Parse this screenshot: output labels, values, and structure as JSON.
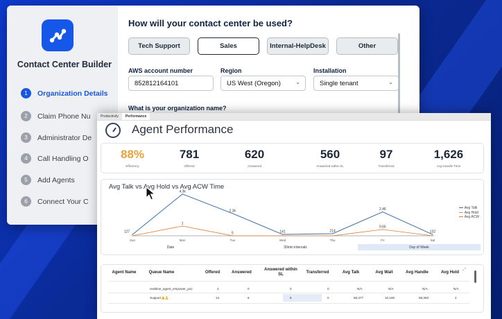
{
  "builder": {
    "app_name": "Contact Center Builder",
    "question": "How will your contact center be used?",
    "options": [
      "Tech Support",
      "Sales",
      "Internal-HelpDesk",
      "Other"
    ],
    "selected_option": "Sales",
    "steps": [
      {
        "num": "1",
        "label": "Organization Details"
      },
      {
        "num": "2",
        "label": "Claim Phone Nu"
      },
      {
        "num": "3",
        "label": "Administrator De"
      },
      {
        "num": "4",
        "label": "Call Handling O"
      },
      {
        "num": "5",
        "label": "Add Agents"
      },
      {
        "num": "6",
        "label": "Connect Your C"
      }
    ],
    "aws_label": "AWS account number",
    "aws_value": "852812164101",
    "region_label": "Region",
    "region_value": "US West (Oregon)",
    "install_label": "Installation",
    "install_value": "Single tenant",
    "org_question": "What is your organization name?"
  },
  "dashboard": {
    "tabs": [
      "Productivity",
      "Performance"
    ],
    "active_tab": "Performance",
    "title": "Agent Performance",
    "kpis": [
      {
        "value": "88%",
        "label": "Efficiency"
      },
      {
        "value": "781",
        "label": "Offered"
      },
      {
        "value": "620",
        "label": "Answered"
      },
      {
        "value": "560",
        "label": "Answered within SL"
      },
      {
        "value": "97",
        "label": "Transferred"
      },
      {
        "value": "1,626",
        "label": "Avg Handle Time"
      }
    ],
    "controls": [
      "Date",
      "30min intervals",
      "Day of Week"
    ],
    "table_headers": [
      "Agent Name",
      "Queue Name",
      "Offered",
      "Answered",
      "Answered within SL",
      "Transferred",
      "Avg Talk",
      "Avg Wait",
      "Avg Handle",
      "Avg Hold"
    ],
    "rows": [
      {
        "queue": "realtime_agent_empower_poc",
        "offered": "2",
        "answered": "0",
        "within_sl": "0",
        "transferred": "0",
        "talk": "N/A",
        "wait": "N/A",
        "handle": "N/A",
        "hold": "N/A"
      },
      {
        "queue": "Support👍🙏",
        "offered": "14",
        "answered": "6",
        "within_sl": "6",
        "transferred": "0",
        "talk": "58,377",
        "wait": "10,160",
        "handle": "58,383",
        "hold": "2"
      }
    ],
    "colors": {
      "talk": "#3a6ea5",
      "hold": "#9aa0a6",
      "acw": "#e07b2c",
      "accent": "#1a56e0"
    }
  },
  "chart_data": {
    "type": "line",
    "title": "Avg Talk vs Avg Hold vs Avg ACW Time",
    "categories": [
      "Sun",
      "Mon",
      "Tue",
      "Wed",
      "Thu",
      "Fri",
      "Sat"
    ],
    "series": [
      {
        "name": "Avg Talk",
        "values": [
          127,
          4300,
          2300,
          141,
          214,
          2460,
          132
        ],
        "labels": [
          "127",
          "4.3k",
          "2.3k",
          "141",
          "214",
          "2.46",
          "132"
        ]
      },
      {
        "name": "Avg Hold",
        "values": [
          0,
          0,
          0,
          0,
          0,
          0,
          0
        ],
        "labels": [
          "",
          "",
          "",
          "",
          "",
          "",
          ""
        ]
      },
      {
        "name": "Avg ACW",
        "values": [
          0,
          1000,
          5,
          0,
          0,
          650,
          0
        ],
        "labels": [
          "",
          "1",
          "5",
          "",
          "",
          "0.65",
          ""
        ]
      }
    ],
    "ylim": [
      0,
      4500
    ],
    "legend": "right"
  }
}
